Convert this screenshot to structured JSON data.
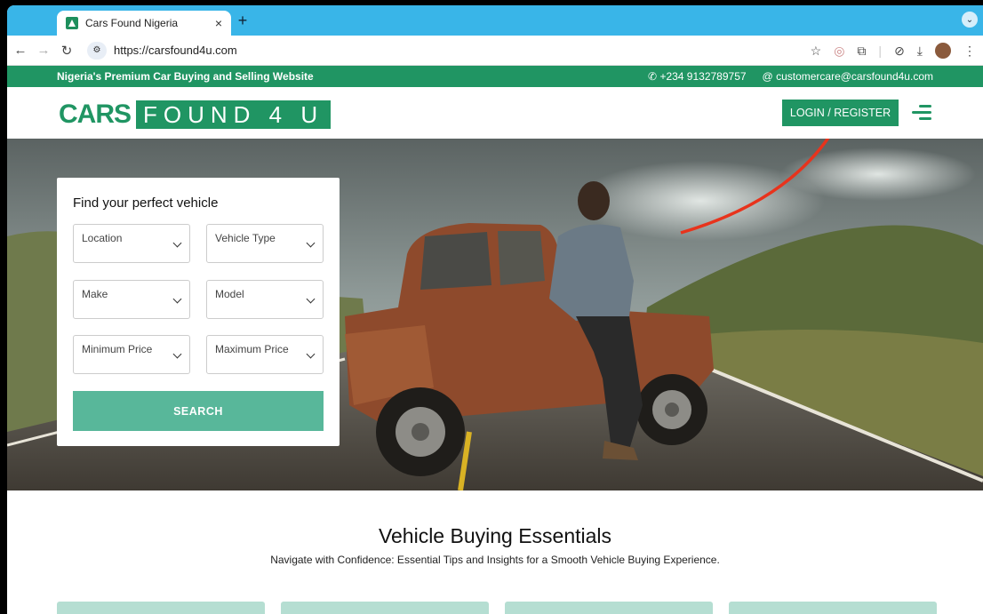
{
  "browser": {
    "tab_title": "Cars Found Nigeria",
    "tab_close": "×",
    "new_tab": "+",
    "url": "https://carsfound4u.com"
  },
  "topbar": {
    "tagline": "Nigeria's Premium Car Buying and Selling Website",
    "phone": "+234 9132789757",
    "email": "@ customercare@carsfound4u.com"
  },
  "header": {
    "logo_cars": "CARS",
    "logo_found": "FOUND 4 U",
    "login_label": "LOGIN / REGISTER"
  },
  "search": {
    "title": "Find your perfect vehicle",
    "fields": [
      "Location",
      "Vehicle Type",
      "Make",
      "Model",
      "Minimum Price",
      "Maximum Price"
    ],
    "button": "SEARCH"
  },
  "essentials": {
    "title": "Vehicle Buying Essentials",
    "subtitle": "Navigate with Confidence: Essential Tips and Insights for a Smooth Vehicle Buying Experience."
  },
  "colors": {
    "brand_green": "#209563",
    "button_green": "#58b79a",
    "card_green": "#b5ded2",
    "arrow_red": "#e8331c"
  }
}
